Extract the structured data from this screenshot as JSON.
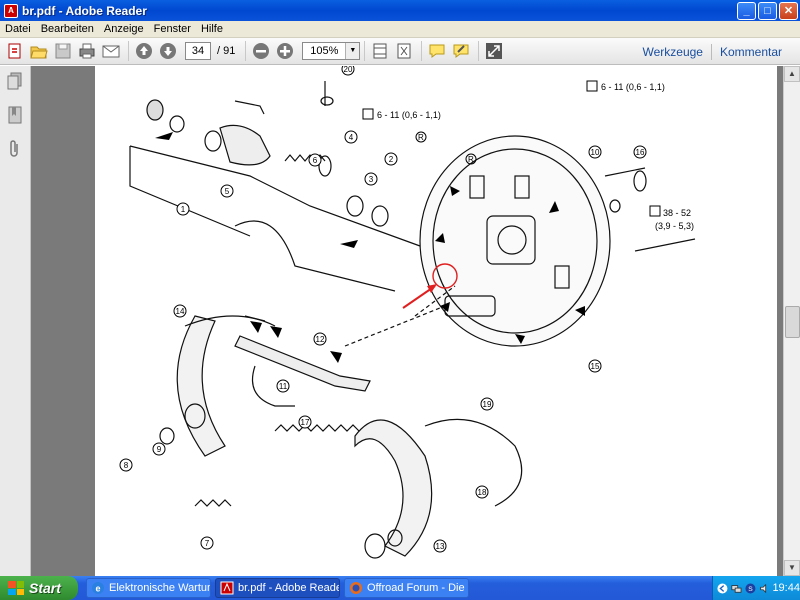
{
  "window": {
    "title": "br.pdf - Adobe Reader",
    "app_icon": "pdf-icon"
  },
  "menu": [
    "Datei",
    "Bearbeiten",
    "Anzeige",
    "Fenster",
    "Hilfe"
  ],
  "toolbar": {
    "page_current": "34",
    "page_total": "/ 91",
    "zoom": "105%",
    "werkzeuge": "Werkzeuge",
    "kommentar": "Kommentar"
  },
  "diagram": {
    "torque_top_left": "6 - 11 (0,6 - 1,1)",
    "torque_top_right": "6 - 11 (0,6 - 1,1)",
    "torque_right_a": "38 - 52",
    "torque_right_b": "(3,9 - 5,3)",
    "callouts": [
      "1",
      "2",
      "3",
      "4",
      "5",
      "6",
      "7",
      "8",
      "9",
      "10",
      "11",
      "12",
      "13",
      "14",
      "15",
      "16",
      "17",
      "18",
      "19",
      "20"
    ],
    "r_label": "R",
    "annotation_color": "#e02020"
  },
  "taskbar": {
    "start": "Start",
    "tasks": [
      {
        "label": "Elektronische Wartun...",
        "icon": "ie-icon"
      },
      {
        "label": "br.pdf - Adobe Reader",
        "icon": "pdf-icon"
      },
      {
        "label": "Offroad Forum - Die ...",
        "icon": "firefox-icon"
      }
    ],
    "clock": "19:44"
  }
}
